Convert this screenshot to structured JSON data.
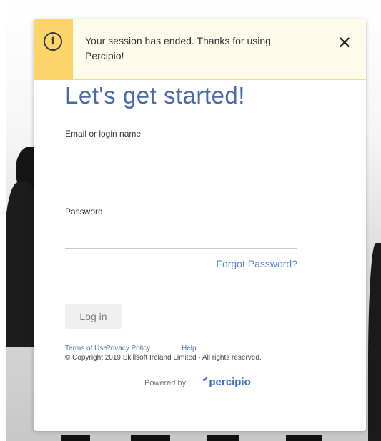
{
  "banner": {
    "message": "Your session has ended. Thanks for using Percipio!",
    "info_icon": "ⓘ",
    "close_icon": "✕"
  },
  "login": {
    "heading": "Let's get started!",
    "email_label": "Email or login name",
    "email_value": "",
    "password_label": "Password",
    "password_value": "",
    "forgot_password": "Forgot Password?",
    "login_button": "Log in"
  },
  "footer": {
    "terms": "Terms of Use",
    "privacy": "Privacy Policy",
    "help": "Help",
    "copyright": "© Copyright 2019 Skillsoft Ireland Limited - All rights reserved.",
    "powered_by": "Powered by",
    "brand": "percipio"
  },
  "colors": {
    "banner_accent": "#fcd46a",
    "heading": "#4a6aa5",
    "link": "#5a87c9"
  }
}
